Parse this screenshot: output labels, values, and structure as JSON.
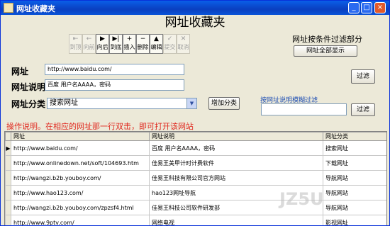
{
  "window": {
    "title": "网址收藏夹",
    "min": "_",
    "max": "□",
    "close": "×"
  },
  "app_title": "网址收藏夹",
  "toolbar": [
    {
      "label": "到顶",
      "glyph": "⇤",
      "enabled": false
    },
    {
      "label": "向前",
      "glyph": "←",
      "enabled": false
    },
    {
      "label": "向后",
      "glyph": "▶",
      "enabled": true
    },
    {
      "label": "到底",
      "glyph": "▶|",
      "enabled": true
    },
    {
      "label": "插入",
      "glyph": "+",
      "enabled": true
    },
    {
      "label": "删除",
      "glyph": "−",
      "enabled": true
    },
    {
      "label": "编辑",
      "glyph": "▲",
      "enabled": true
    },
    {
      "label": "提交",
      "glyph": "✓",
      "enabled": false
    },
    {
      "label": "取消",
      "glyph": "✕",
      "enabled": false
    }
  ],
  "filter": {
    "title": "网址按条件过滤部分",
    "show_all": "网址全部显示",
    "filter_btn": "过滤",
    "search_legend": "按网址说明模糊过滤",
    "search_value": "",
    "filter_btn2": "过滤"
  },
  "form": {
    "url_label": "网址",
    "url_value": "http://www.baidu.com/",
    "desc_label": "网址说明",
    "desc_value": "百度  用户名AAAA，密码",
    "cat_label": "网址分类",
    "cat_value": "搜索网址",
    "add_cat": "增加分类"
  },
  "hint": "操作说明。在相应的网址那一行双击，即可打开该网站",
  "table": {
    "headers": [
      "网址",
      "网址说明",
      "网址分类"
    ],
    "rows": [
      [
        "http://www.baidu.com/",
        "百度  用户名AAAA，密码",
        "搜索网址"
      ],
      [
        "http://www.onlinedown.net/soft/104693.htm",
        "佳易王美甲计时计费软件",
        "下载网址"
      ],
      [
        "http://wangzi.b2b.youboy.com/",
        "佳易王科技有限公司官方网站",
        "导航网站"
      ],
      [
        "http://www.hao123.com/",
        "hao123网址导航",
        "导航网站"
      ],
      [
        "http://wangzi.b2b.youboy.com/zpzsf4.html",
        "佳易王科技公司软件研发部",
        "导航网站"
      ],
      [
        "http://www.9ptv.com/",
        "网络电视",
        "影视网址"
      ]
    ]
  },
  "watermark": "JZ5U"
}
